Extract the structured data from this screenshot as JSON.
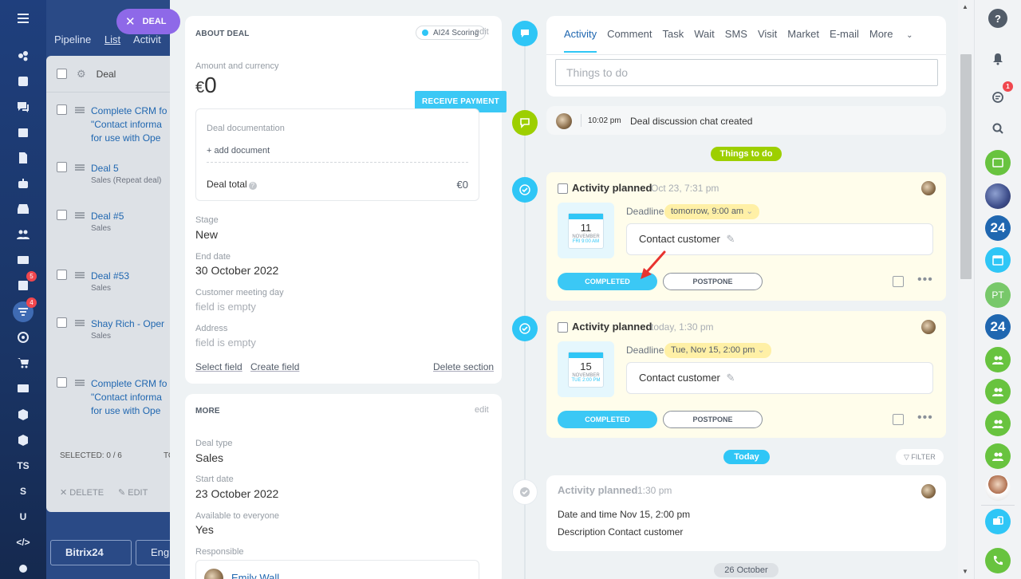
{
  "left_nav": {
    "badges": {
      "tasks": "5",
      "filter": "4"
    },
    "text_items": [
      "TS",
      "S",
      "U"
    ]
  },
  "deal_pill": {
    "label": "DEAL"
  },
  "background_list": {
    "tabs": [
      "Pipeline",
      "List",
      "Activit"
    ],
    "header": "Deal",
    "rows": [
      {
        "title": "Complete CRM fo \"Contact informa for use with Ope",
        "sub": ""
      },
      {
        "title": "Deal 5",
        "sub": "Sales (Repeat deal)"
      },
      {
        "title": "Deal #5",
        "sub": "Sales"
      },
      {
        "title": "Deal #53",
        "sub": "Sales"
      },
      {
        "title": "Shay Rich - Oper",
        "sub": "Sales"
      },
      {
        "title": "Complete CRM fo \"Contact informa for use with Ope",
        "sub": ""
      }
    ],
    "selected": "SELECTED: 0 / 6",
    "selected_cut": "TO",
    "delete": "DELETE",
    "edit": "EDIT",
    "brand": "Bitrix24",
    "lang": "English"
  },
  "about_deal": {
    "title": "ABOUT DEAL",
    "ai_badge": "AI24 Scoring",
    "edit": "edit",
    "amount_label": "Amount and currency",
    "currency_symbol": "€",
    "amount": "0",
    "receive_payment": "RECEIVE PAYMENT",
    "doc_label": "Deal documentation",
    "add_document": "+ add document",
    "deal_total_label": "Deal total",
    "deal_total_value": "€0",
    "fields": [
      {
        "label": "Stage",
        "value": "New"
      },
      {
        "label": "End date",
        "value": "30 October 2022"
      },
      {
        "label": "Customer meeting day",
        "value": "field is empty"
      },
      {
        "label": "Address",
        "value": "field is empty"
      }
    ],
    "select_field": "Select field",
    "create_field": "Create field",
    "delete_section": "Delete section"
  },
  "more": {
    "title": "MORE",
    "edit": "edit",
    "fields": [
      {
        "label": "Deal type",
        "value": "Sales"
      },
      {
        "label": "Start date",
        "value": "23 October 2022"
      },
      {
        "label": "Available to everyone",
        "value": "Yes"
      },
      {
        "label": "Responsible",
        "value": ""
      }
    ],
    "responsible_name": "Emily Wall"
  },
  "timeline": {
    "tabs": [
      "Activity",
      "Comment",
      "Task",
      "Wait",
      "SMS",
      "Visit",
      "Market",
      "E-mail",
      "More"
    ],
    "input_placeholder": "Things to do",
    "chat_time": "10:02 pm",
    "chat_text": "Deal discussion chat created",
    "things_to_do_label": "Things to do",
    "activities": [
      {
        "title": "Activity planned",
        "time": "Oct 23, 7:31 pm",
        "cal_day": "11",
        "cal_month": "NOVEMBER",
        "cal_time": "FRI 9:00 AM",
        "deadline_label": "Deadline",
        "deadline": "tomorrow, 9:00 am",
        "subject": "Contact customer",
        "completed": "COMPLETED",
        "postpone": "POSTPONE"
      },
      {
        "title": "Activity planned",
        "time": "today, 1:30 pm",
        "cal_day": "15",
        "cal_month": "NOVEMBER",
        "cal_time": "TUE 2:00 PM",
        "deadline_label": "Deadline",
        "deadline": "Tue, Nov 15, 2:00 pm",
        "subject": "Contact customer",
        "completed": "COMPLETED",
        "postpone": "POSTPONE"
      }
    ],
    "today_label": "Today",
    "filter_label": "FILTER",
    "done": {
      "title": "Activity planned",
      "time": "1:30 pm",
      "datetime_label": "Date and time",
      "datetime_value": "Nov 15, 2:00 pm",
      "desc_label": "Description",
      "desc_value": "Contact customer"
    },
    "date_label": "26 October"
  },
  "right_bar": {
    "help": "?",
    "chat_badge": "1",
    "b24": "24",
    "pt": "PT"
  },
  "colors": {
    "accent": "#2fc6f6",
    "green": "#9dcf00",
    "nav": "#1f3f7d",
    "deadline_bg": "#fff0a6"
  }
}
